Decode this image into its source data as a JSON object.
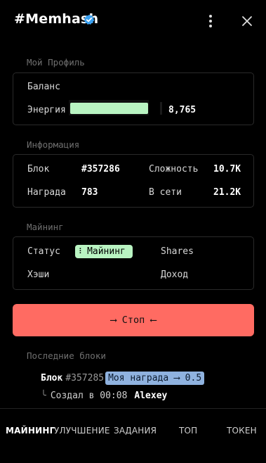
{
  "app": {
    "title": "#Memhash"
  },
  "profile": {
    "section_label": "Мой Профиль",
    "balance_label": "Баланс",
    "energy_label": "Энергия",
    "energy_value": "8,765",
    "energy_fraction": 0.97
  },
  "info": {
    "section_label": "Информация",
    "block_label": "Блок",
    "block_value": "#357286",
    "difficulty_label": "Сложность",
    "difficulty_value": "10.7K",
    "reward_label": "Награда",
    "reward_value": "783",
    "online_label": "В сети",
    "online_value": "21.2K"
  },
  "mining": {
    "section_label": "Майнинг",
    "status_label": "Статус",
    "status_value": "Майнинг",
    "shares_label": "Shares",
    "hashes_label": "Хэши",
    "income_label": "Доход"
  },
  "stop_button": {
    "label": "⟶ Стоп ⟵"
  },
  "recent": {
    "section_label": "Последние блоки",
    "block_label": "Блок",
    "block_number": "#357285",
    "reward_text": "Моя награда ⟶ 0.5",
    "created_text": "Создал в 00:08",
    "author": "Alexey"
  },
  "nav": {
    "items": [
      {
        "label": "МАЙНИНГ",
        "active": true
      },
      {
        "label": "УЛУЧШЕНИЕ",
        "active": false
      },
      {
        "label": "ЗАДАНИЯ",
        "active": false
      },
      {
        "label": "ТОП",
        "active": false
      },
      {
        "label": "ТОКЕН",
        "active": false
      }
    ]
  }
}
